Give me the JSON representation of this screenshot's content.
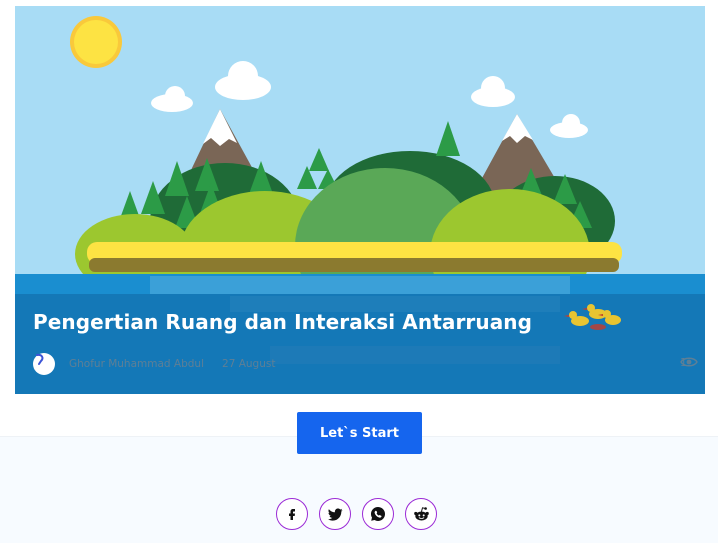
{
  "article": {
    "title": "Pengertian Ruang dan Interaksi Antarruang",
    "author": "Ghofur Muhammad Abdul",
    "date": "27 August",
    "views": "1",
    "hero_image": "island-landscape-illustration"
  },
  "actions": {
    "start_label": "Let`s Start",
    "start_color": "#1565ee"
  },
  "share": {
    "items": [
      {
        "name": "facebook",
        "icon": "facebook-icon"
      },
      {
        "name": "twitter",
        "icon": "twitter-icon"
      },
      {
        "name": "whatsapp",
        "icon": "whatsapp-icon"
      },
      {
        "name": "reddit",
        "icon": "reddit-icon"
      }
    ],
    "border_color": "#9b2bd6"
  },
  "colors": {
    "sky": "#a8dcf5",
    "sea": "#1a8ed0",
    "overlay": "#1a6ea8"
  }
}
